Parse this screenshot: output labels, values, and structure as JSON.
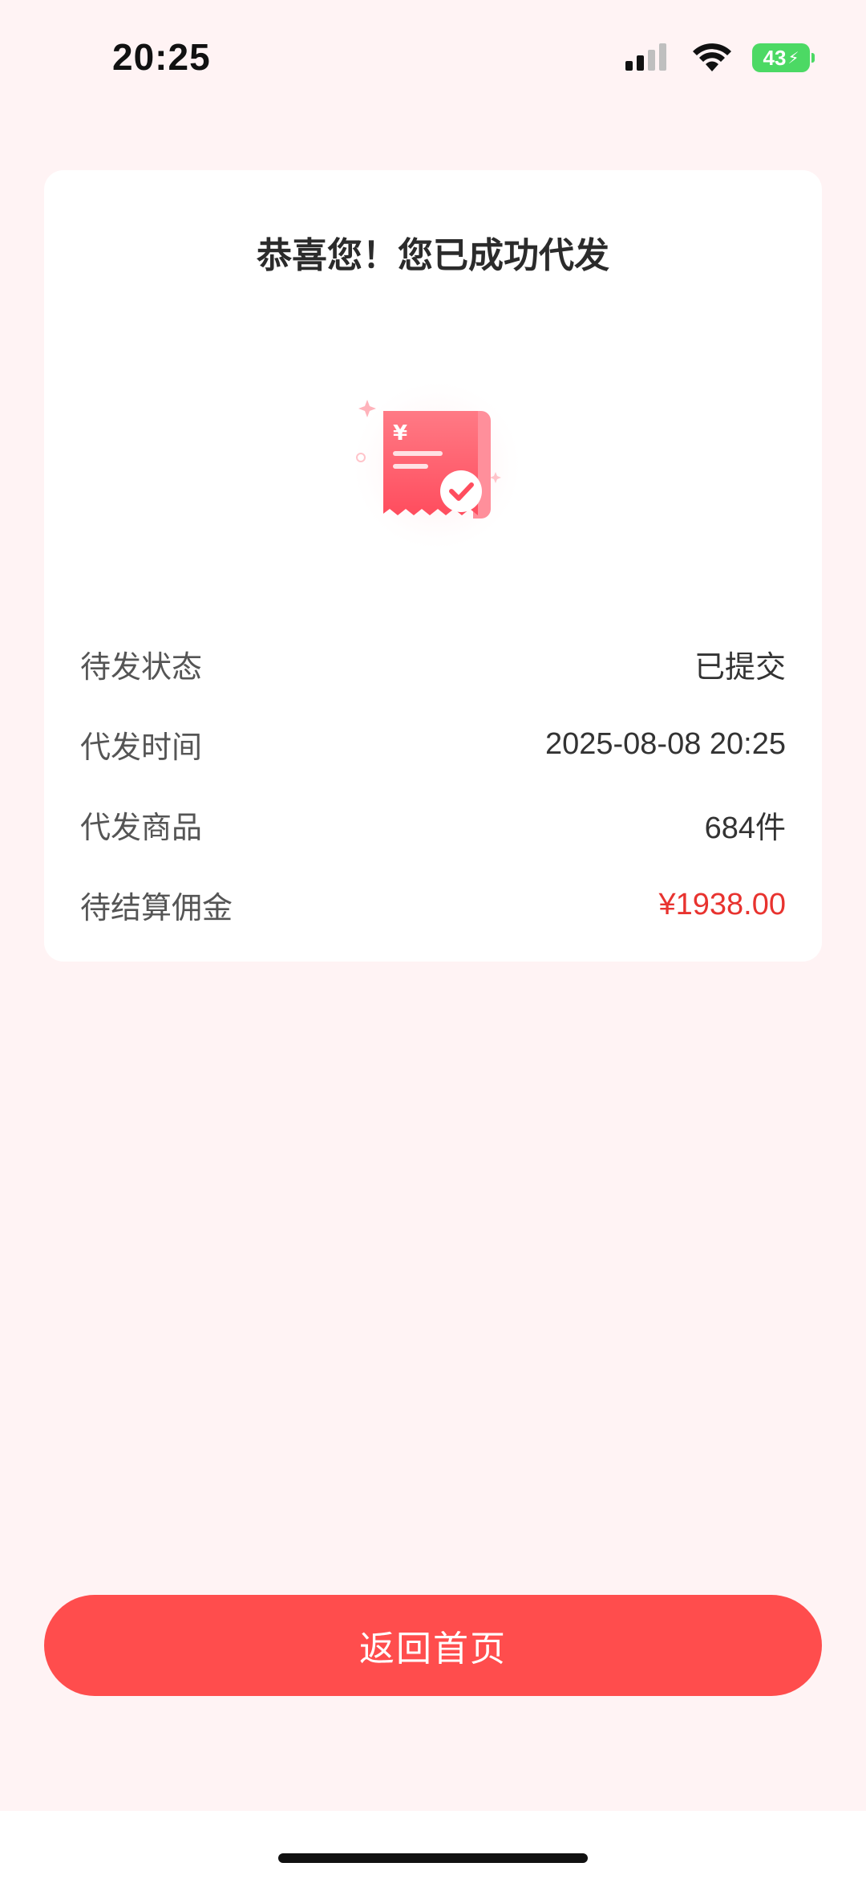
{
  "status_bar": {
    "time": "20:25",
    "battery": "43",
    "icons": [
      "signal-icon",
      "wifi-icon",
      "battery-icon",
      "charging-bolt-icon"
    ]
  },
  "card": {
    "title": "恭喜您！您已成功代发",
    "illustration_icon": "receipt-success-icon",
    "illustration_symbol": "¥",
    "rows": [
      {
        "label": "待发状态",
        "value": "已提交"
      },
      {
        "label": "代发时间",
        "value": "2025-08-08 20:25"
      },
      {
        "label": "代发商品",
        "value": "684件"
      },
      {
        "label": "待结算佣金",
        "value": "¥1938.00"
      }
    ]
  },
  "footer": {
    "home_button": "返回首页"
  },
  "colors": {
    "background": "#fff3f4",
    "accent": "#ff4d4d",
    "commission_text": "#e8332f",
    "battery": "#4cd964"
  }
}
